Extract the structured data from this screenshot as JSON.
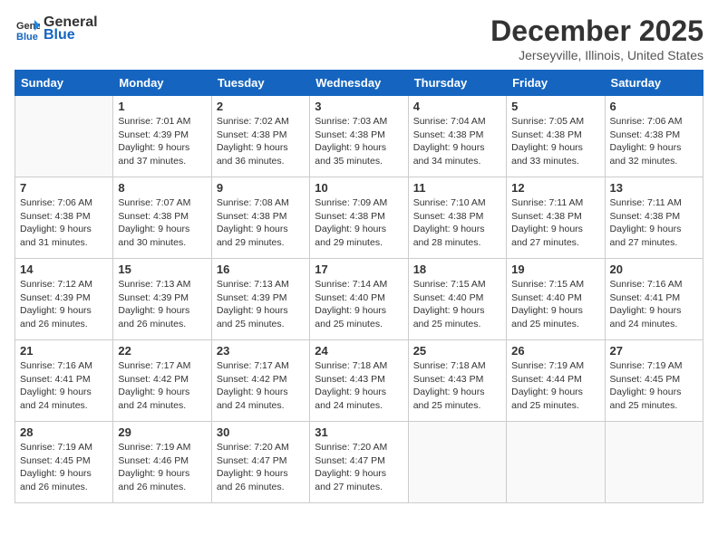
{
  "header": {
    "logo_general": "General",
    "logo_blue": "Blue",
    "title": "December 2025",
    "location": "Jerseyville, Illinois, United States"
  },
  "days_of_week": [
    "Sunday",
    "Monday",
    "Tuesday",
    "Wednesday",
    "Thursday",
    "Friday",
    "Saturday"
  ],
  "weeks": [
    [
      {
        "day": "",
        "lines": []
      },
      {
        "day": "1",
        "lines": [
          "Sunrise: 7:01 AM",
          "Sunset: 4:39 PM",
          "Daylight: 9 hours",
          "and 37 minutes."
        ]
      },
      {
        "day": "2",
        "lines": [
          "Sunrise: 7:02 AM",
          "Sunset: 4:38 PM",
          "Daylight: 9 hours",
          "and 36 minutes."
        ]
      },
      {
        "day": "3",
        "lines": [
          "Sunrise: 7:03 AM",
          "Sunset: 4:38 PM",
          "Daylight: 9 hours",
          "and 35 minutes."
        ]
      },
      {
        "day": "4",
        "lines": [
          "Sunrise: 7:04 AM",
          "Sunset: 4:38 PM",
          "Daylight: 9 hours",
          "and 34 minutes."
        ]
      },
      {
        "day": "5",
        "lines": [
          "Sunrise: 7:05 AM",
          "Sunset: 4:38 PM",
          "Daylight: 9 hours",
          "and 33 minutes."
        ]
      },
      {
        "day": "6",
        "lines": [
          "Sunrise: 7:06 AM",
          "Sunset: 4:38 PM",
          "Daylight: 9 hours",
          "and 32 minutes."
        ]
      }
    ],
    [
      {
        "day": "7",
        "lines": [
          "Sunrise: 7:06 AM",
          "Sunset: 4:38 PM",
          "Daylight: 9 hours",
          "and 31 minutes."
        ]
      },
      {
        "day": "8",
        "lines": [
          "Sunrise: 7:07 AM",
          "Sunset: 4:38 PM",
          "Daylight: 9 hours",
          "and 30 minutes."
        ]
      },
      {
        "day": "9",
        "lines": [
          "Sunrise: 7:08 AM",
          "Sunset: 4:38 PM",
          "Daylight: 9 hours",
          "and 29 minutes."
        ]
      },
      {
        "day": "10",
        "lines": [
          "Sunrise: 7:09 AM",
          "Sunset: 4:38 PM",
          "Daylight: 9 hours",
          "and 29 minutes."
        ]
      },
      {
        "day": "11",
        "lines": [
          "Sunrise: 7:10 AM",
          "Sunset: 4:38 PM",
          "Daylight: 9 hours",
          "and 28 minutes."
        ]
      },
      {
        "day": "12",
        "lines": [
          "Sunrise: 7:11 AM",
          "Sunset: 4:38 PM",
          "Daylight: 9 hours",
          "and 27 minutes."
        ]
      },
      {
        "day": "13",
        "lines": [
          "Sunrise: 7:11 AM",
          "Sunset: 4:38 PM",
          "Daylight: 9 hours",
          "and 27 minutes."
        ]
      }
    ],
    [
      {
        "day": "14",
        "lines": [
          "Sunrise: 7:12 AM",
          "Sunset: 4:39 PM",
          "Daylight: 9 hours",
          "and 26 minutes."
        ]
      },
      {
        "day": "15",
        "lines": [
          "Sunrise: 7:13 AM",
          "Sunset: 4:39 PM",
          "Daylight: 9 hours",
          "and 26 minutes."
        ]
      },
      {
        "day": "16",
        "lines": [
          "Sunrise: 7:13 AM",
          "Sunset: 4:39 PM",
          "Daylight: 9 hours",
          "and 25 minutes."
        ]
      },
      {
        "day": "17",
        "lines": [
          "Sunrise: 7:14 AM",
          "Sunset: 4:40 PM",
          "Daylight: 9 hours",
          "and 25 minutes."
        ]
      },
      {
        "day": "18",
        "lines": [
          "Sunrise: 7:15 AM",
          "Sunset: 4:40 PM",
          "Daylight: 9 hours",
          "and 25 minutes."
        ]
      },
      {
        "day": "19",
        "lines": [
          "Sunrise: 7:15 AM",
          "Sunset: 4:40 PM",
          "Daylight: 9 hours",
          "and 25 minutes."
        ]
      },
      {
        "day": "20",
        "lines": [
          "Sunrise: 7:16 AM",
          "Sunset: 4:41 PM",
          "Daylight: 9 hours",
          "and 24 minutes."
        ]
      }
    ],
    [
      {
        "day": "21",
        "lines": [
          "Sunrise: 7:16 AM",
          "Sunset: 4:41 PM",
          "Daylight: 9 hours",
          "and 24 minutes."
        ]
      },
      {
        "day": "22",
        "lines": [
          "Sunrise: 7:17 AM",
          "Sunset: 4:42 PM",
          "Daylight: 9 hours",
          "and 24 minutes."
        ]
      },
      {
        "day": "23",
        "lines": [
          "Sunrise: 7:17 AM",
          "Sunset: 4:42 PM",
          "Daylight: 9 hours",
          "and 24 minutes."
        ]
      },
      {
        "day": "24",
        "lines": [
          "Sunrise: 7:18 AM",
          "Sunset: 4:43 PM",
          "Daylight: 9 hours",
          "and 24 minutes."
        ]
      },
      {
        "day": "25",
        "lines": [
          "Sunrise: 7:18 AM",
          "Sunset: 4:43 PM",
          "Daylight: 9 hours",
          "and 25 minutes."
        ]
      },
      {
        "day": "26",
        "lines": [
          "Sunrise: 7:19 AM",
          "Sunset: 4:44 PM",
          "Daylight: 9 hours",
          "and 25 minutes."
        ]
      },
      {
        "day": "27",
        "lines": [
          "Sunrise: 7:19 AM",
          "Sunset: 4:45 PM",
          "Daylight: 9 hours",
          "and 25 minutes."
        ]
      }
    ],
    [
      {
        "day": "28",
        "lines": [
          "Sunrise: 7:19 AM",
          "Sunset: 4:45 PM",
          "Daylight: 9 hours",
          "and 26 minutes."
        ]
      },
      {
        "day": "29",
        "lines": [
          "Sunrise: 7:19 AM",
          "Sunset: 4:46 PM",
          "Daylight: 9 hours",
          "and 26 minutes."
        ]
      },
      {
        "day": "30",
        "lines": [
          "Sunrise: 7:20 AM",
          "Sunset: 4:47 PM",
          "Daylight: 9 hours",
          "and 26 minutes."
        ]
      },
      {
        "day": "31",
        "lines": [
          "Sunrise: 7:20 AM",
          "Sunset: 4:47 PM",
          "Daylight: 9 hours",
          "and 27 minutes."
        ]
      },
      {
        "day": "",
        "lines": []
      },
      {
        "day": "",
        "lines": []
      },
      {
        "day": "",
        "lines": []
      }
    ]
  ]
}
